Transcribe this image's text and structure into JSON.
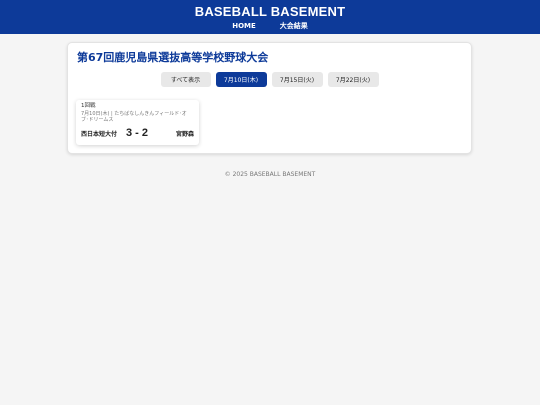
{
  "header": {
    "site_title": "BASEBALL BASEMENT",
    "nav": [
      {
        "label": "HOME"
      },
      {
        "label": "大会結果"
      }
    ]
  },
  "tournament": {
    "title": "第67回鹿児島県選抜高等学校野球大会",
    "tabs": [
      {
        "label": "すべて表示",
        "active": false
      },
      {
        "label": "7月10日(木)",
        "active": true
      },
      {
        "label": "7月15日(火)",
        "active": false
      },
      {
        "label": "7月22日(火)",
        "active": false
      }
    ]
  },
  "matches": [
    {
      "round": "1回戦",
      "info": "7月10日(木) | たちばなしんきんフィールド･オブ･ドリームス",
      "home_team": "西日本短大付",
      "score": "3 - 2",
      "away_team": "宮野森"
    }
  ],
  "footer": {
    "copyright": "© 2025 BASEBALL BASEMENT"
  },
  "colors": {
    "brand": "#0d3a99",
    "background": "#f5f5f5"
  }
}
